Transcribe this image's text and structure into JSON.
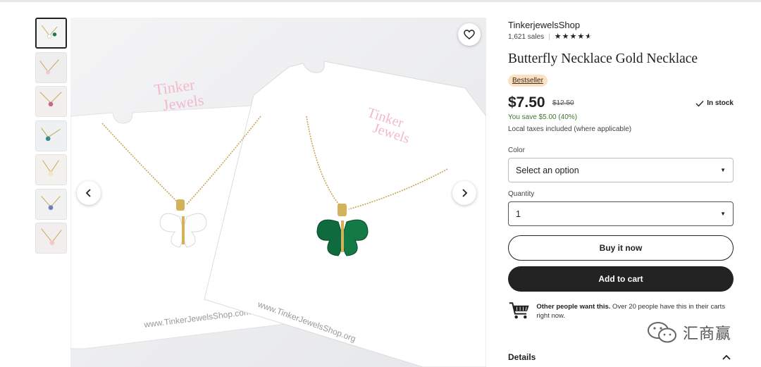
{
  "listing": {
    "shop_name": "TinkerjewelsShop",
    "sales_count": "1,621 sales",
    "rating_stars": 4.5,
    "title": "Butterfly Necklace Gold Necklace",
    "badge": "Bestseller",
    "price": "$7.50",
    "original_price": "$12.50",
    "stock_status": "In stock",
    "savings": "You save $5.00 (40%)",
    "taxes_note": "Local taxes included (where applicable)"
  },
  "options": {
    "color_label": "Color",
    "color_value": "Select an option",
    "quantity_label": "Quantity",
    "quantity_value": "1"
  },
  "actions": {
    "buy_now": "Buy it now",
    "add_to_cart": "Add to cart"
  },
  "demand": {
    "bold": "Other people want this.",
    "text": " Over 20 people have this in their carts right now."
  },
  "details_label": "Details",
  "gallery": {
    "thumbnail_count": 7,
    "active_index": 0,
    "product_images": [
      {
        "card_text": "Tinker Jewels",
        "card_url": "www.TinkerJewelsShop.com"
      },
      {
        "card_text": "Tinker Jewels",
        "card_url": "www.TinkerJewelsShop.org"
      }
    ]
  },
  "watermark": "汇商赢",
  "colors": {
    "badge_bg": "#fbe1c4",
    "savings_green": "#3a7a2c",
    "button_dark": "#222222"
  }
}
